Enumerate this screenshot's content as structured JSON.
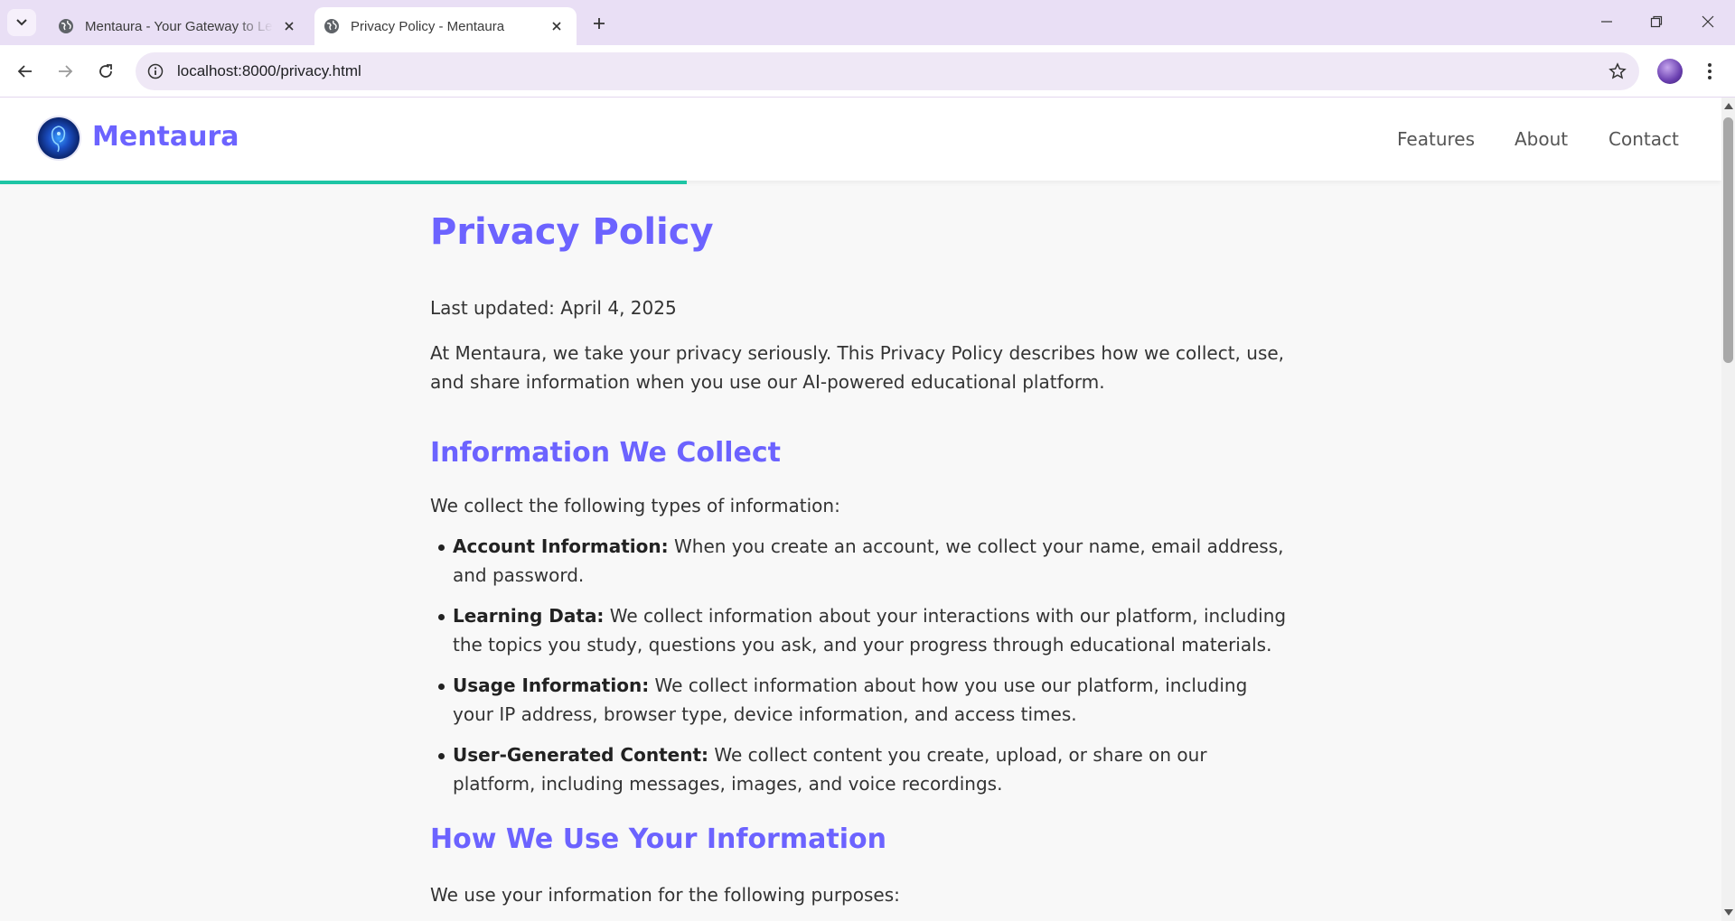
{
  "browser": {
    "tabs": [
      {
        "title": "Mentaura - Your Gateway to Learning",
        "active": false
      },
      {
        "title": "Privacy Policy - Mentaura",
        "active": true
      }
    ],
    "url": "localhost:8000/privacy.html"
  },
  "site": {
    "brand": "Mentaura",
    "nav": [
      "Features",
      "About",
      "Contact"
    ],
    "accent_color": "#6c63ff",
    "progress_color": "#1ec5a5"
  },
  "page": {
    "title": "Privacy Policy",
    "last_updated": "Last updated: April 4, 2025",
    "intro": "At Mentaura, we take your privacy seriously. This Privacy Policy describes how we collect, use, and share information when you use our AI-powered educational platform.",
    "section1": {
      "heading": "Information We Collect",
      "lead": "We collect the following types of information:",
      "items": [
        {
          "label": "Account Information:",
          "text": " When you create an account, we collect your name, email address, and password."
        },
        {
          "label": "Learning Data:",
          "text": " We collect information about your interactions with our platform, including the topics you study, questions you ask, and your progress through educational materials."
        },
        {
          "label": "Usage Information:",
          "text": " We collect information about how you use our platform, including your IP address, browser type, device information, and access times."
        },
        {
          "label": "User-Generated Content:",
          "text": " We collect content you create, upload, or share on our platform, including messages, images, and voice recordings."
        }
      ]
    },
    "section2": {
      "heading": "How We Use Your Information",
      "lead": "We use your information for the following purposes:"
    }
  }
}
